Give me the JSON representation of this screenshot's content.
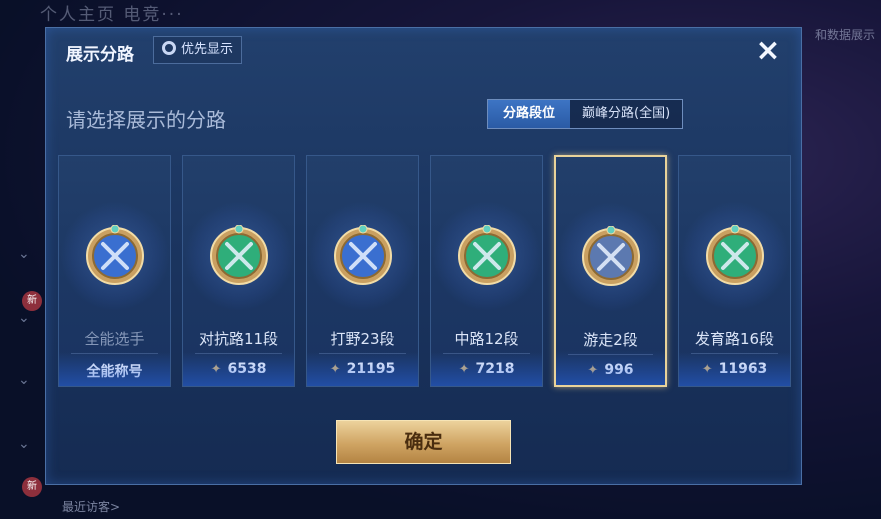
{
  "background": {
    "top_left_text": "个人主页    电竞···",
    "top_right_text": "和数据展示",
    "bottom_text": "最近访客>",
    "side_badges": [
      "新",
      "新"
    ]
  },
  "modal": {
    "title": "展示分路",
    "priority_button": "优先显示",
    "close_icon": "×",
    "subtitle": "请选择展示的分路",
    "tabs": [
      {
        "label": "分路段位",
        "active": true
      },
      {
        "label": "巅峰分路(全国)",
        "active": false
      }
    ],
    "cards": [
      {
        "label": "全能选手",
        "stat": "全能称号",
        "show_star": false,
        "emblem": "allround-emblem-icon",
        "color": "#3a6fd0",
        "selected": false
      },
      {
        "label": "对抗路11段",
        "stat": "6538",
        "show_star": true,
        "emblem": "clash-lane-emblem-icon",
        "color": "#2fae7a",
        "selected": false
      },
      {
        "label": "打野23段",
        "stat": "21195",
        "show_star": true,
        "emblem": "jungle-emblem-icon",
        "color": "#3a6fd0",
        "selected": false
      },
      {
        "label": "中路12段",
        "stat": "7218",
        "show_star": true,
        "emblem": "mid-lane-emblem-icon",
        "color": "#2fae7a",
        "selected": false
      },
      {
        "label": "游走2段",
        "stat": "996",
        "show_star": true,
        "emblem": "roam-emblem-icon",
        "color": "#5c79b0",
        "selected": true
      },
      {
        "label": "发育路16段",
        "stat": "11963",
        "show_star": true,
        "emblem": "farm-lane-emblem-icon",
        "color": "#2fae7a",
        "selected": false
      }
    ],
    "confirm_button": "确定"
  }
}
